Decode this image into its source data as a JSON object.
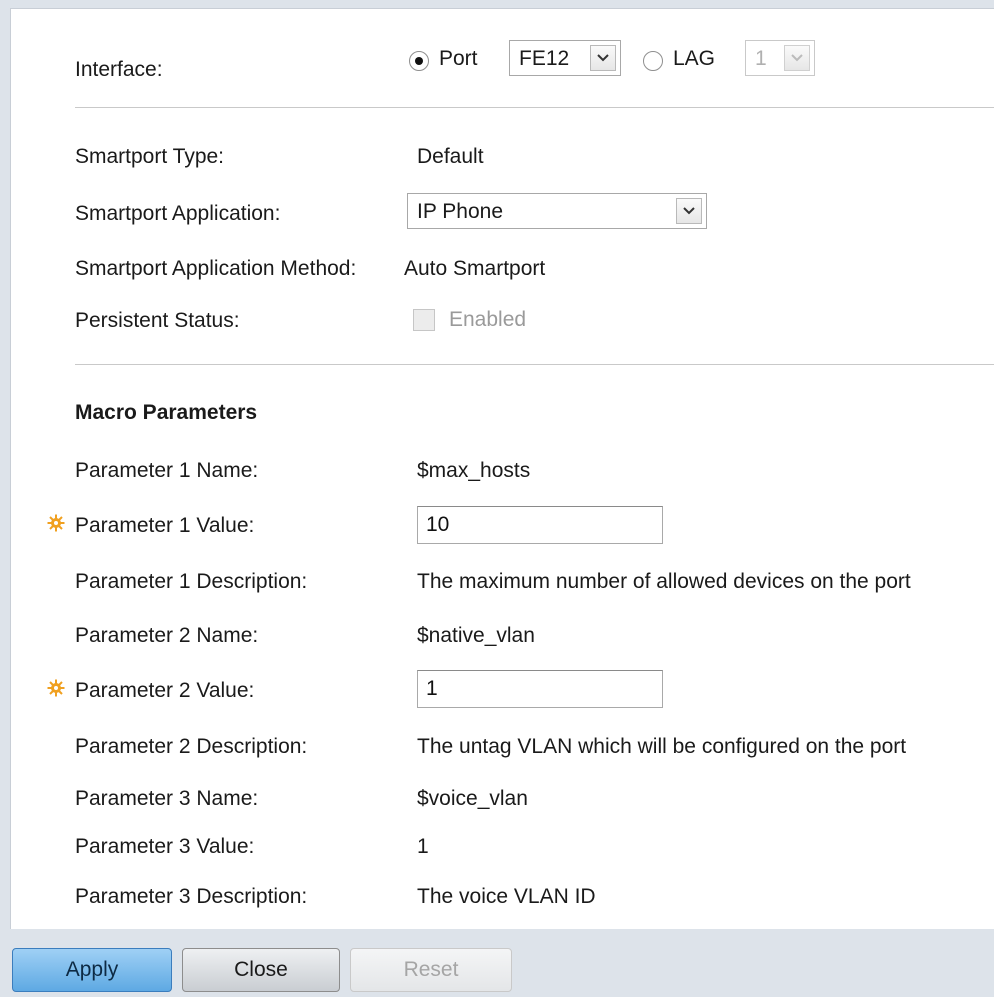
{
  "interface": {
    "label": "Interface:",
    "port_label": "Port",
    "port_value": "FE12",
    "port_selected": true,
    "lag_label": "LAG",
    "lag_value": "1"
  },
  "smartport": {
    "type_label": "Smartport Type:",
    "type_value": "Default",
    "application_label": "Smartport Application:",
    "application_value": "IP Phone",
    "method_label": "Smartport Application Method:",
    "method_value": "Auto Smartport",
    "persistent_label": "Persistent Status:",
    "persistent_checkbox_label": "Enabled",
    "persistent_checked": false
  },
  "macro": {
    "heading": "Macro Parameters",
    "p1_name_label": "Parameter 1 Name:",
    "p1_name_value": "$max_hosts",
    "p1_value_label": "Parameter 1 Value:",
    "p1_value": "10",
    "p1_desc_label": "Parameter 1 Description:",
    "p1_desc_value": "The maximum number of allowed devices on the port",
    "p2_name_label": "Parameter 2 Name:",
    "p2_name_value": "$native_vlan",
    "p2_value_label": "Parameter 2 Value:",
    "p2_value": "1",
    "p2_desc_label": "Parameter 2 Description:",
    "p2_desc_value": "The untag VLAN which will be configured on the port",
    "p3_name_label": "Parameter 3 Name:",
    "p3_name_value": "$voice_vlan",
    "p3_value_label": "Parameter 3 Value:",
    "p3_value": "1",
    "p3_desc_label": "Parameter 3 Description:",
    "p3_desc_value": "The voice VLAN ID"
  },
  "buttons": {
    "apply": "Apply",
    "close": "Close",
    "reset": "Reset"
  },
  "colors": {
    "required_icon": "#f0a020",
    "apply_button": "#5ea9e3"
  },
  "icons": {
    "required": "gear-icon",
    "dropdown": "chevron-down-icon"
  }
}
